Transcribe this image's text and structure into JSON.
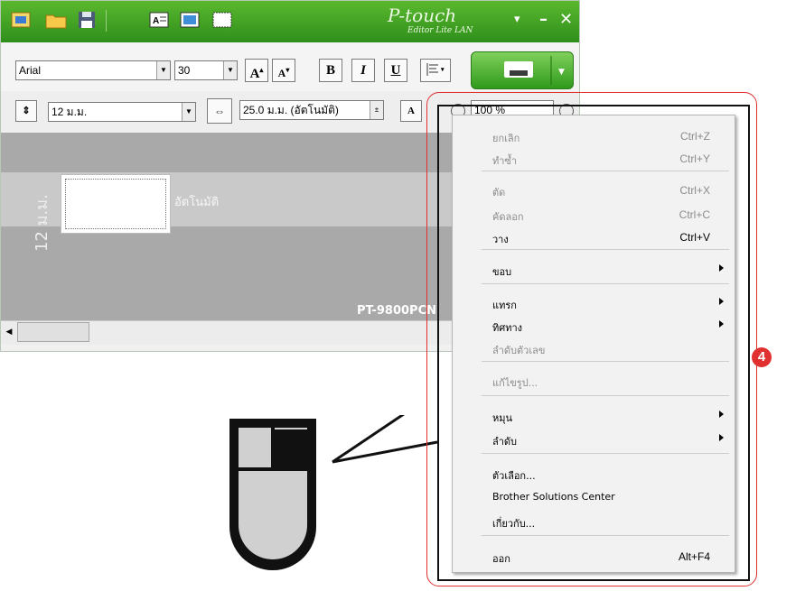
{
  "title_bar": {
    "logo_main": "P-touch",
    "logo_sub": "Editor Lite LAN",
    "minimize_glyph": "–",
    "close_glyph": "✕",
    "menu_glyph": "▾"
  },
  "format_toolbar": {
    "font_name": "Arial",
    "font_size": "30",
    "bold": "B",
    "italic": "I",
    "underline": "U"
  },
  "layout_toolbar": {
    "tape_width": "12 ม.ม.",
    "label_length": "25.0 ม.ม. (อัตโนมัติ)",
    "zoom": "100 %"
  },
  "canvas": {
    "tape_width_vertical": "12 ม.ม.",
    "auto_text": "อัตโนมัติ",
    "printer_model": "PT-9800PCN"
  },
  "context_menu": {
    "items": [
      {
        "label": "ยกเลิก",
        "shortcut": "Ctrl+Z",
        "enabled": false,
        "submenu": false
      },
      {
        "label": "ทำซ้ำ",
        "shortcut": "Ctrl+Y",
        "enabled": false,
        "submenu": false
      },
      {
        "label": "ตัด",
        "shortcut": "Ctrl+X",
        "enabled": false,
        "submenu": false
      },
      {
        "label": "คัดลอก",
        "shortcut": "Ctrl+C",
        "enabled": false,
        "submenu": false
      },
      {
        "label": "วาง",
        "shortcut": "Ctrl+V",
        "enabled": true,
        "submenu": false
      },
      {
        "label": "ขอบ",
        "shortcut": "",
        "enabled": true,
        "submenu": true
      },
      {
        "label": "แทรก",
        "shortcut": "",
        "enabled": true,
        "submenu": true
      },
      {
        "label": "ทิศทาง",
        "shortcut": "",
        "enabled": true,
        "submenu": true
      },
      {
        "label": "ลำดับตัวเลข",
        "shortcut": "",
        "enabled": false,
        "submenu": false
      },
      {
        "label": "แก้ไขรูป...",
        "shortcut": "",
        "enabled": false,
        "submenu": false
      },
      {
        "label": "หมุน",
        "shortcut": "",
        "enabled": true,
        "submenu": true
      },
      {
        "label": "ลำดับ",
        "shortcut": "",
        "enabled": true,
        "submenu": true
      },
      {
        "label": "ตัวเลือก...",
        "shortcut": "",
        "enabled": true,
        "submenu": false
      },
      {
        "label": "Brother Solutions Center",
        "shortcut": "",
        "enabled": true,
        "submenu": false
      },
      {
        "label": "เกี่ยวกับ...",
        "shortcut": "",
        "enabled": true,
        "submenu": false
      },
      {
        "label": "ออก",
        "shortcut": "Alt+F4",
        "enabled": true,
        "submenu": false
      }
    ]
  },
  "annotation": {
    "callout_number": "4"
  },
  "icons": [
    "new-label-icon",
    "open-folder-icon",
    "save-disk-icon",
    "text-box-icon",
    "image-frame-icon",
    "frame-icon",
    "font-size-up-icon",
    "font-size-down-icon",
    "align-icon",
    "print-icon",
    "tape-width-icon",
    "label-length-icon",
    "vertical-text-icon",
    "zoom-out-icon",
    "zoom-in-icon",
    "mouse-right-click-icon"
  ],
  "colors": {
    "title_green": "#2f8f1b",
    "callout_red": "#e03030"
  }
}
